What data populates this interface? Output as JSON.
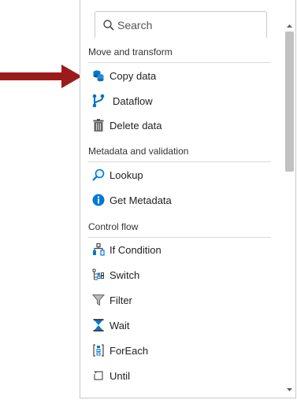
{
  "search": {
    "placeholder": "Search"
  },
  "sections": {
    "move": {
      "title": "Move and transform",
      "items": [
        {
          "label": "Copy data",
          "icon": "copy-data-icon"
        },
        {
          "label": "Dataflow",
          "icon": "dataflow-icon"
        },
        {
          "label": "Delete data",
          "icon": "trash-icon"
        }
      ]
    },
    "metadata": {
      "title": "Metadata and validation",
      "items": [
        {
          "label": "Lookup",
          "icon": "magnifier-icon"
        },
        {
          "label": "Get Metadata",
          "icon": "info-icon"
        }
      ]
    },
    "control": {
      "title": "Control flow",
      "items": [
        {
          "label": "If Condition",
          "icon": "if-condition-icon"
        },
        {
          "label": "Switch",
          "icon": "switch-icon"
        },
        {
          "label": "Filter",
          "icon": "filter-icon"
        },
        {
          "label": "Wait",
          "icon": "hourglass-icon"
        },
        {
          "label": "ForEach",
          "icon": "foreach-icon"
        },
        {
          "label": "Until",
          "icon": "until-icon"
        }
      ]
    }
  },
  "colors": {
    "arrow": "#9b1b1b",
    "accent": "#0078d4",
    "dataflow": "#0072c6"
  }
}
